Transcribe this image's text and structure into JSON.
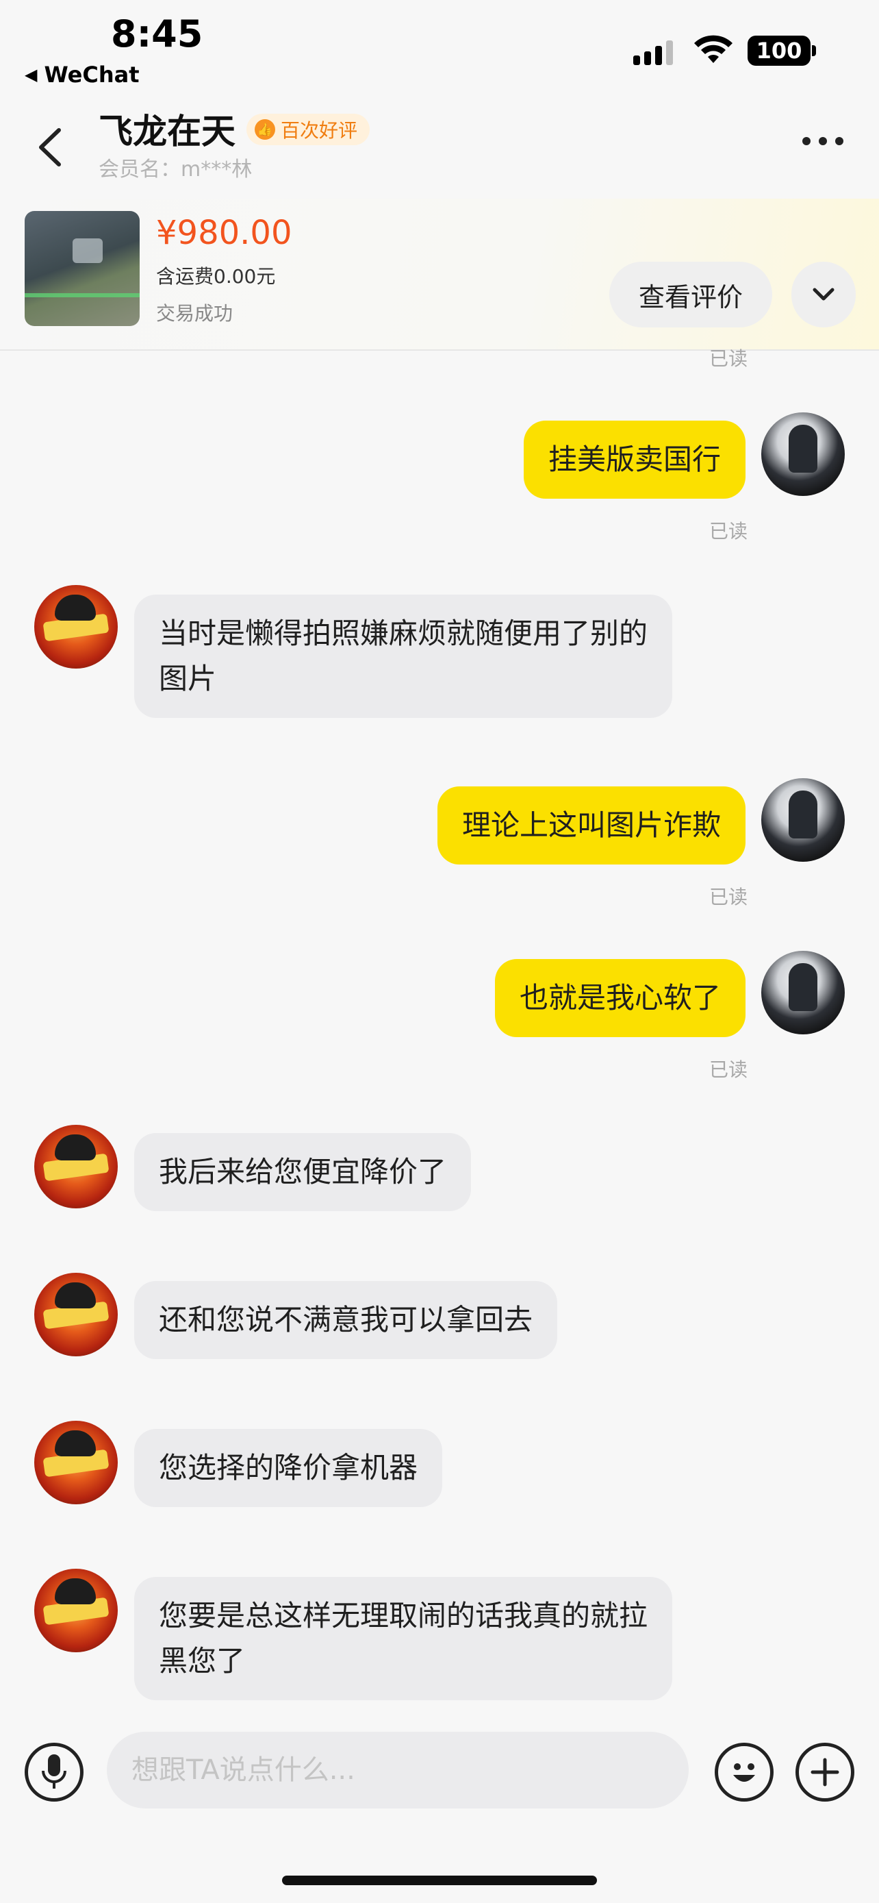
{
  "status_bar": {
    "time": "8:45",
    "back_app": "WeChat",
    "battery": "100"
  },
  "header": {
    "contact_name": "飞龙在天",
    "badge": "百次好评",
    "member_name": "会员名：m***林"
  },
  "product": {
    "price": "¥980.00",
    "shipping": "含运费0.00元",
    "status": "交易成功",
    "review_button": "查看评价"
  },
  "chat": {
    "top_read": "已读",
    "messages": [
      {
        "sender": "me",
        "text": "挂美版卖国行",
        "read": "已读"
      },
      {
        "sender": "other",
        "text": "当时是懒得拍照嫌麻烦就随便用了别的\n图片"
      },
      {
        "sender": "me",
        "text": "理论上这叫图片诈欺",
        "read": "已读"
      },
      {
        "sender": "me",
        "text": "也就是我心软了",
        "read": "已读"
      },
      {
        "sender": "other",
        "text": "我后来给您便宜降价了"
      },
      {
        "sender": "other",
        "text": "还和您说不满意我可以拿回去"
      },
      {
        "sender": "other",
        "text": "您选择的降价拿机器"
      },
      {
        "sender": "other",
        "text": "您要是总这样无理取闹的话我真的就拉\n黑您了"
      }
    ]
  },
  "input": {
    "placeholder": "想跟TA说点什么..."
  },
  "colors": {
    "my_bubble": "#fbe000",
    "their_bubble": "#ebebed",
    "price": "#f2541e",
    "badge_text": "#f07d10"
  },
  "icons": [
    "back-triangle-icon",
    "signal-icon",
    "wifi-icon",
    "battery-icon",
    "back-chevron-icon",
    "more-icon",
    "chevron-down-icon",
    "microphone-icon",
    "emoji-icon",
    "plus-icon"
  ]
}
